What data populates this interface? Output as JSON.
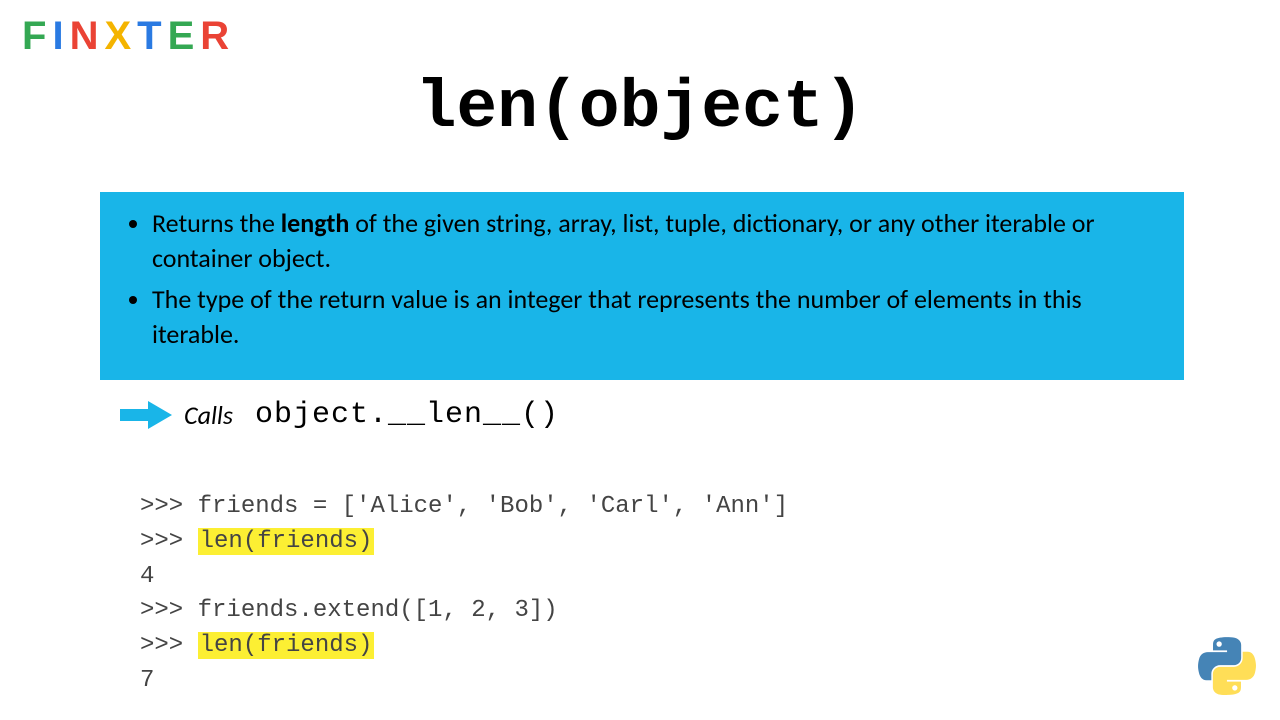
{
  "logo": {
    "letters": [
      "f",
      "i",
      "n",
      "x",
      "t",
      "e",
      "r"
    ]
  },
  "title": "len(object)",
  "info": {
    "bullet1_pre": "Returns the ",
    "bullet1_bold": "length",
    "bullet1_post": " of the given string, array, list, tuple, dictionary, or any other iterable or container object.",
    "bullet2": "The type of the return value is an integer that represents the number of elements in this iterable."
  },
  "calls": {
    "label": "Calls",
    "expr": "object.__len__()"
  },
  "code": {
    "l1": ">>> friends = ['Alice', 'Bob', 'Carl', 'Ann']",
    "l2_prompt": ">>> ",
    "l2_hl": "len(friends)",
    "l3": "4",
    "l4": ">>> friends.extend([1, 2, 3])",
    "l5_prompt": ">>> ",
    "l5_hl": "len(friends)",
    "l6": "7"
  }
}
